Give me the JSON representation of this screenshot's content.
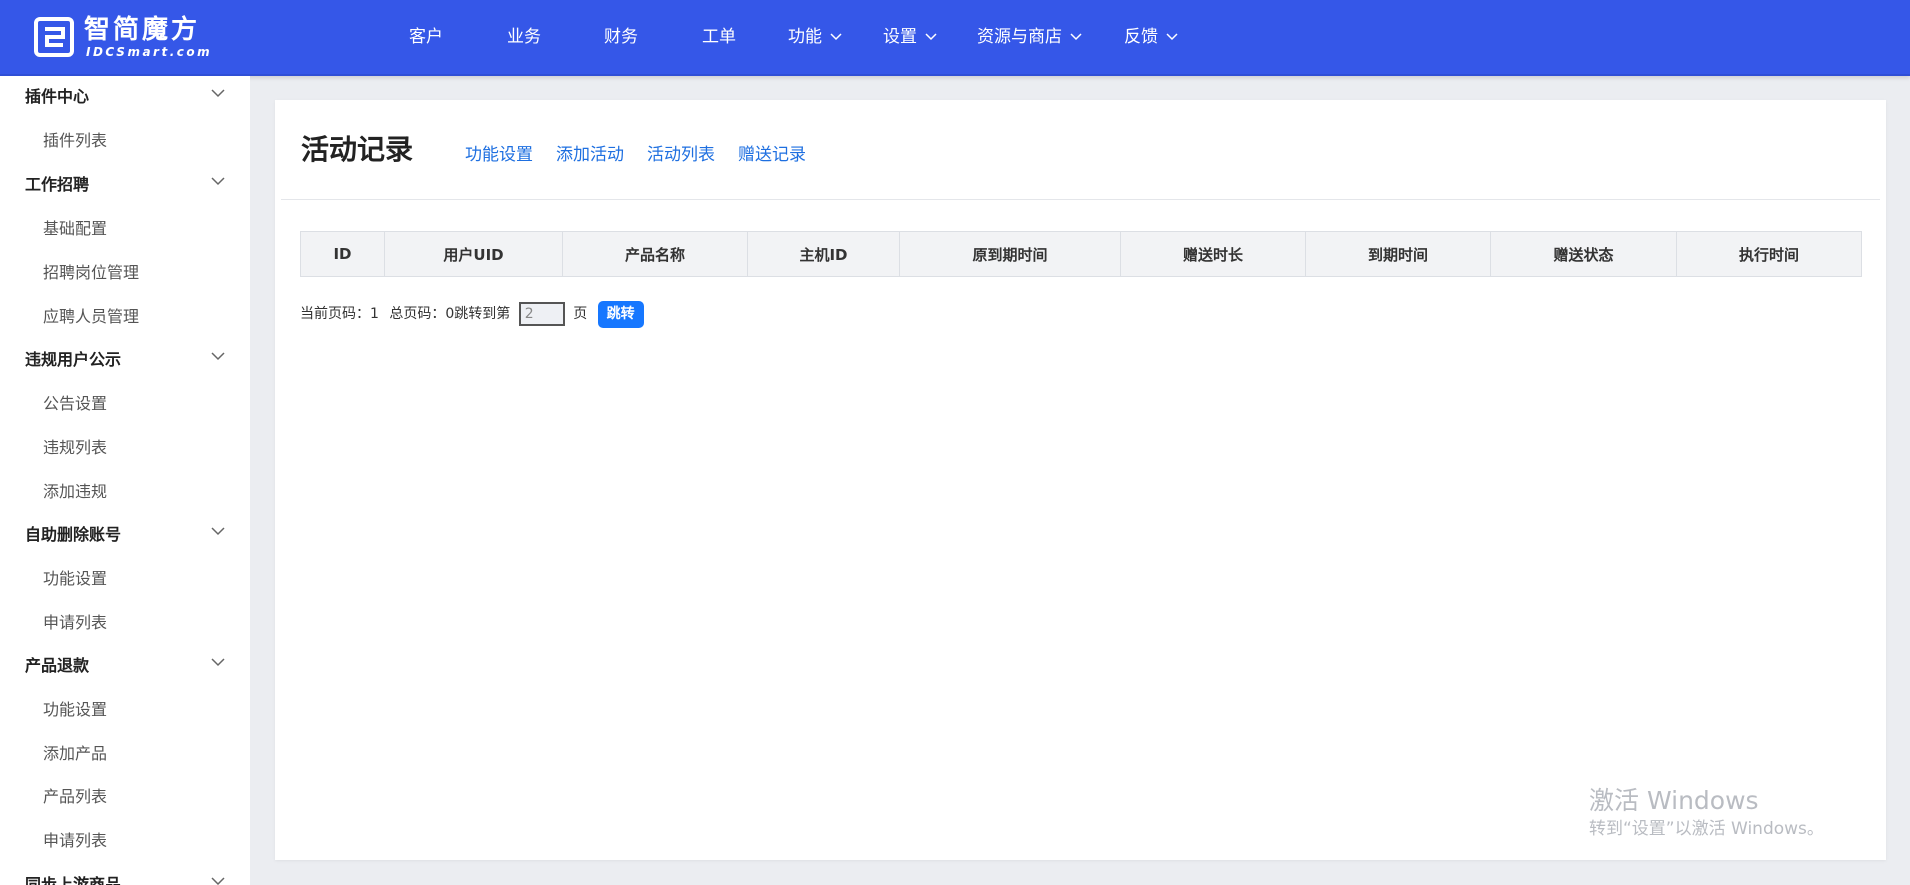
{
  "brand": {
    "cn": "智简魔方",
    "en": "IDCSmart.com"
  },
  "nav": [
    {
      "label": "客户",
      "dropdown": false
    },
    {
      "label": "业务",
      "dropdown": false
    },
    {
      "label": "财务",
      "dropdown": false
    },
    {
      "label": "工单",
      "dropdown": false
    },
    {
      "label": "功能",
      "dropdown": true
    },
    {
      "label": "设置",
      "dropdown": true
    },
    {
      "label": "资源与商店",
      "dropdown": true
    },
    {
      "label": "反馈",
      "dropdown": true
    }
  ],
  "sidebar": {
    "groups": [
      {
        "label": "插件中心",
        "items": [
          "插件列表"
        ]
      },
      {
        "label": "工作招聘",
        "items": [
          "基础配置",
          "招聘岗位管理",
          "应聘人员管理"
        ]
      },
      {
        "label": "违规用户公示",
        "items": [
          "公告设置",
          "违规列表",
          "添加违规"
        ]
      },
      {
        "label": "自助删除账号",
        "items": [
          "功能设置",
          "申请列表"
        ]
      },
      {
        "label": "产品退款",
        "items": [
          "功能设置",
          "添加产品",
          "产品列表",
          "申请列表"
        ]
      },
      {
        "label": "同步上游商品",
        "items": []
      }
    ]
  },
  "main": {
    "title": "活动记录",
    "tabs": [
      "功能设置",
      "添加活动",
      "活动列表",
      "赠送记录"
    ],
    "table": {
      "columns": [
        "ID",
        "用户UID",
        "产品名称",
        "主机ID",
        "原到期时间",
        "赠送时长",
        "到期时间",
        "赠送状态",
        "执行时间"
      ],
      "rows": []
    },
    "pagination": {
      "current_label": "当前页码：",
      "current": "1",
      "total_label": "总页码：",
      "total": "0",
      "jump_prefix": "跳转到第",
      "jump_value": "2",
      "jump_suffix": "页",
      "jump_button": "跳转"
    }
  },
  "watermark": {
    "line1": "激活 Windows",
    "line2": "转到“设置”以激活 Windows。"
  },
  "colors": {
    "header": "#3557e8",
    "link": "#1e6fe0",
    "button": "#1677ff",
    "page_bg": "#ebedf1"
  }
}
